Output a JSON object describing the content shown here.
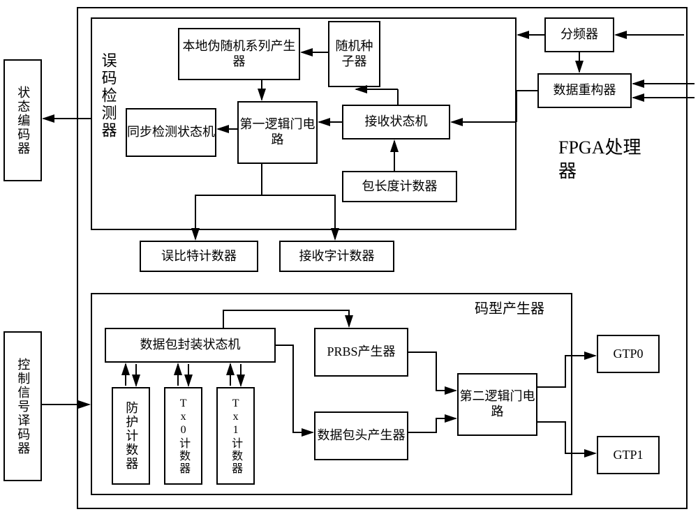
{
  "outer": {
    "status_encoder": "状态编码器",
    "control_signal_decoder": "控制信号译码器"
  },
  "fpga": {
    "label": "FPGA处理器",
    "divider": "分频器",
    "data_reconstructor": "数据重构器",
    "gtp0": "GTP0",
    "gtp1": "GTP1"
  },
  "error_detector": {
    "label": "误码检测器",
    "local_prbs_gen": "本地伪随机系列产生器",
    "random_seed": "随机种子器",
    "sync_detect_sm": "同步检测状态机",
    "first_logic_gate": "第一逻辑门电路",
    "rx_state_machine": "接收状态机",
    "packet_len_counter": "包长度计数器",
    "error_bit_counter": "误比特计数器",
    "rx_word_counter": "接收字计数器"
  },
  "pattern_gen": {
    "label": "码型产生器",
    "packet_encap_sm": "数据包封装状态机",
    "prbs_gen": "PRBS产生器",
    "packet_header_gen": "数据包头产生器",
    "second_logic_gate": "第二逻辑门电路",
    "protect_counter": "防护计数器",
    "tx0_counter": "Tx0计数器",
    "tx1_counter": "Tx1计数器"
  }
}
